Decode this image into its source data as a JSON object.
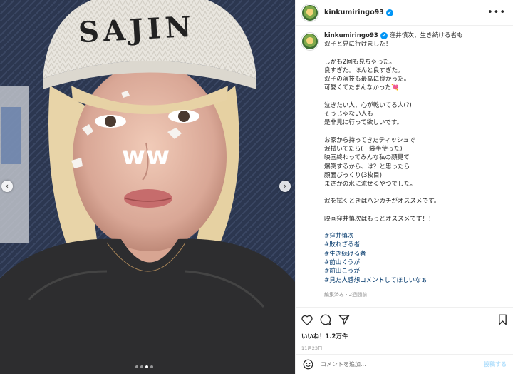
{
  "post": {
    "username": "kinkumiringo93",
    "verified": "✔",
    "more_icon": "more-horizontal-icon",
    "photo": {
      "overlay_text": "ww",
      "beanie_text": "SAJIN",
      "carousel_count": 4,
      "carousel_active": 2
    },
    "caption": {
      "first_line": "窪井慎次、生き続ける者も",
      "lines": [
        "双子と見に行けました！",
        "",
        "しかも2回も見ちゃった。",
        "良すぎた。ほんと良すぎた。",
        "双子の演技も最高に良かった。",
        "可愛くてたまんなかった💘",
        "",
        "泣きたい人、心が乾いてる人(?)",
        "そうじゃない人も",
        "是非見に行って欲しいです。",
        "",
        "お家から持ってきたティッシュで",
        "涙拭いてたら(一袋半使った)",
        "映画終わってみんな私の顔見て",
        "爆笑するから、は？と思ったら",
        "顔面びっくり(3枚目)",
        "まさかの水に流せるやつでした。",
        "",
        "涙を拭くときはハンカチがオススメです。",
        "",
        "映画窪井慎次はもっとオススメです！！",
        ""
      ],
      "hashtags": [
        "#窪井慎次",
        "#敗れざる者",
        "#生き続ける者",
        "#前山くうが",
        "#前山こうが",
        "#見た人感想コメントしてほしいなぁ"
      ],
      "meta": "編集済み · 2週間前"
    },
    "actions": {
      "like_icon": "heart-icon",
      "comment_icon": "comment-icon",
      "share_icon": "send-icon",
      "save_icon": "bookmark-icon"
    },
    "likes": "いいね！1.2万件",
    "date": "11月23日",
    "comment": {
      "emoji_icon": "smiley-icon",
      "placeholder": "コメントを追加...",
      "post_label": "投稿する"
    }
  },
  "colors": {
    "link": "#00376b",
    "verified": "#0095f6",
    "post_button_disabled": "#b2dffc"
  }
}
